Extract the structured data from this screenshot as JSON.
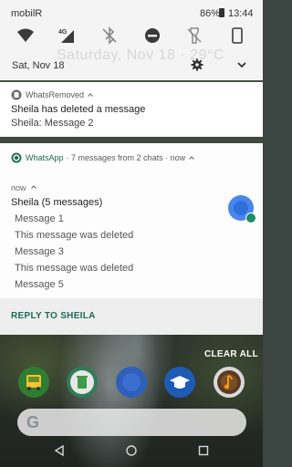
{
  "status_bar": {
    "carrier": "mobilR",
    "battery": "86%",
    "time": "13:44"
  },
  "quick_settings": {
    "date": "Sat, Nov 18",
    "lock_screen_faded": "Saturday, Nov 18 · 29°C",
    "tiles": [
      "wifi-icon",
      "mobile-data-4g-icon",
      "bluetooth-off-icon",
      "do-not-disturb-icon",
      "flashlight-off-icon",
      "rotation-portrait-icon"
    ]
  },
  "notification_1": {
    "app": "WhatsRemoved",
    "title": "Sheila has deleted a message",
    "text": "Sheila: Message 2"
  },
  "notification_2": {
    "app": "WhatsApp",
    "summary": "· 7 messages from 2 chats · now",
    "time": "now",
    "conversation": "Sheila (5 messages)",
    "messages": [
      "Message 1",
      "This message was deleted",
      "Message 3",
      "This message was deleted",
      "Message 5"
    ],
    "action": "REPLY TO SHEILA"
  },
  "clear_all": "CLEAR ALL",
  "colors": {
    "whatsapp_green": "#1c6b55",
    "panel": "#f4f4f4",
    "avatar_blue": "#4a86ea"
  }
}
